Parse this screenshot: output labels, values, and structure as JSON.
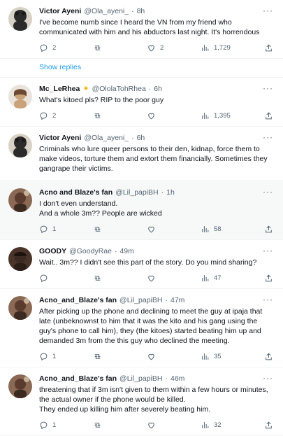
{
  "tweets": [
    {
      "name": "Victor Ayeni",
      "handle": "@Ola_ayeni_",
      "time": "8h",
      "verified": false,
      "lines": [
        "I've become numb since I heard the VN from my friend who communicated with him and his abductors last night. It's horrendous"
      ],
      "replies": "2",
      "retweets": "",
      "likes": "2",
      "views": "1,729",
      "avatar_color": "#2b2b2b"
    },
    {
      "name": "Mc_LeRhea",
      "handle": "@OlolaTohRhea",
      "time": "6h",
      "verified": true,
      "lines": [
        "What's kitoed pls? RIP to the poor guy"
      ],
      "replies": "2",
      "retweets": "",
      "likes": "",
      "views": "1,395",
      "avatar_color": "#c9a27a"
    },
    {
      "name": "Victor Ayeni",
      "handle": "@Ola_ayeni_",
      "time": "6h",
      "verified": false,
      "lines": [
        "Criminals who lure queer persons to their den, kidnap, force them to make videos, torture them and extort them financially. Sometimes they gangrape their victims."
      ],
      "replies": "",
      "retweets": "",
      "likes": "",
      "views": "",
      "avatar_color": "#2b2b2b"
    },
    {
      "name": "Acno and Blaze's fan",
      "handle": "@Lil_papiBH",
      "time": "1h",
      "verified": false,
      "lines": [
        "I don't even understand.",
        "And a whole 3m?? People are wicked"
      ],
      "replies": "1",
      "retweets": "",
      "likes": "",
      "views": "58",
      "avatar_color": "#5a3b2e"
    },
    {
      "name": "GOODY",
      "handle": "@GoodyRae",
      "time": "49m",
      "verified": false,
      "lines": [
        "Wait.. 3m?? I didn't see this part of the story. Do you mind sharing?"
      ],
      "replies": "",
      "retweets": "",
      "likes": "",
      "views": "47",
      "avatar_color": "#3a2a22"
    },
    {
      "name": "Acno_and_Blaze's fan",
      "handle": "@Lil_papiBH",
      "time": "47m",
      "verified": false,
      "lines": [
        "After picking up the phone and declining to meet the guy at ipaja that late (unbeknownst to him that it was the kito and his gang using the guy's phone to call him), they (the kitoes) started beating him up and demanded 3m from the this guy who declined the meeting."
      ],
      "replies": "1",
      "retweets": "",
      "likes": "",
      "views": "35",
      "avatar_color": "#5a3b2e"
    },
    {
      "name": "Acno_and_Blaze's fan",
      "handle": "@Lil_papiBH",
      "time": "46m",
      "verified": false,
      "lines": [
        "threatening that if 3m isn't given to them within a few hours or minutes, the actual owner if the phone would be killed.",
        "They ended up killing him after severely beating him."
      ],
      "replies": "1",
      "retweets": "",
      "likes": "",
      "views": "32",
      "avatar_color": "#5a3b2e"
    }
  ],
  "show_replies_label": "Show replies",
  "icons": {
    "reply": "reply-icon",
    "retweet": "retweet-icon",
    "like": "like-icon",
    "views": "views-icon",
    "share": "share-icon",
    "more": "more-icon"
  },
  "colors": {
    "link": "#1d9bf0",
    "muted": "#536471",
    "text": "#0f1419"
  }
}
